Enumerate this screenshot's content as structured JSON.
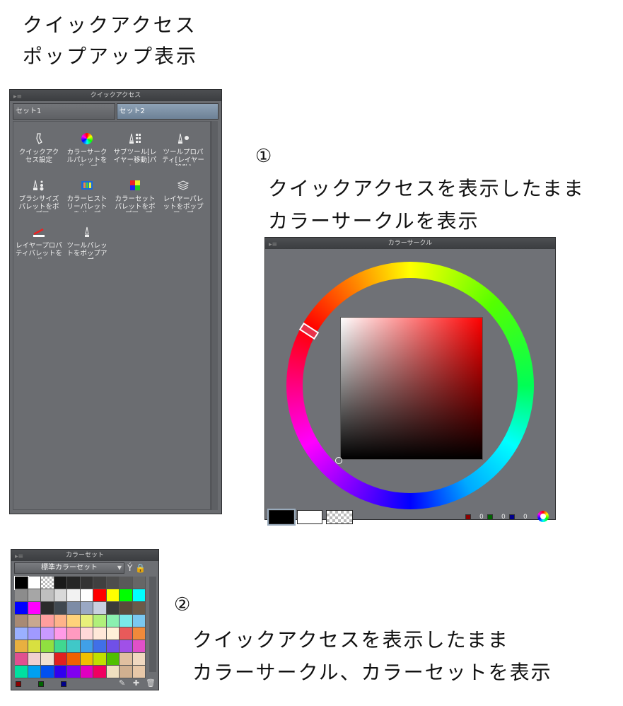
{
  "title_line1": "クイックアクセス",
  "title_line2": "ポップアップ表示",
  "label1": {
    "num": "①",
    "line1": "クイックアクセスを表示したまま",
    "line2": "カラーサークルを表示"
  },
  "label2": {
    "num": "②",
    "line1": "クイックアクセスを表示したまま",
    "line2": "カラーサークル、カラーセットを表示"
  },
  "quick_access": {
    "title": "クイックアクセス",
    "tabs": [
      "セット1",
      "セット2"
    ],
    "items": [
      {
        "label": "クイックアクセス設定",
        "icon": "quick-access-settings-icon"
      },
      {
        "label": "カラーサークルパレットをポップ",
        "icon": "color-circle-icon"
      },
      {
        "label": "サブツール[レイヤー移動]パレッ",
        "icon": "sub-tool-icon"
      },
      {
        "label": "ツールプロパティ[レイヤー移動]",
        "icon": "tool-property-icon"
      },
      {
        "label": "ブラシサイズパレットをポップア",
        "icon": "brush-size-icon"
      },
      {
        "label": "カラーヒストリーパレットをポップ",
        "icon": "color-history-icon"
      },
      {
        "label": "カラーセットパレットをポップアップ",
        "icon": "color-set-icon"
      },
      {
        "label": "レイヤーパレットをポップアップ",
        "icon": "layer-icon"
      },
      {
        "label": "レイヤープロパティパレットをポ",
        "icon": "layer-property-icon"
      },
      {
        "label": "ツールパレットをポップアップ",
        "icon": "tool-palette-icon"
      }
    ]
  },
  "color_circle": {
    "title": "カラーサークル",
    "main_color": "#000000",
    "sub_color": "#ffffff",
    "rgb": {
      "r": "0",
      "g": "0",
      "b": "0"
    }
  },
  "color_set": {
    "title": "カラーセット",
    "set_name": "標準カラーセット",
    "colors": [
      "#000000",
      "#ffffff",
      "checker",
      "#1a1a1a",
      "#262626",
      "#333333",
      "#404040",
      "#4d4d4d",
      "#595959",
      "#666666",
      "#8c8c8c",
      "#a6a6a6",
      "#bfbfbf",
      "#d9d9d9",
      "#f2f2f2",
      "#ffffff",
      "#ff0000",
      "#ffff00",
      "#00ff00",
      "#00ffff",
      "#0000ff",
      "#ff00ff",
      "#2b2b2b",
      "#404850",
      "#7d8ca6",
      "#9aa8c4",
      "#c8d0e0",
      "#3a3a3a",
      "#5a4a3a",
      "#6b5a48",
      "#a88a74",
      "#c8a890",
      "#ff9e9e",
      "#ffb38a",
      "#ffd27a",
      "#e8f07a",
      "#b0f07a",
      "#8af0b0",
      "#7ae8e8",
      "#7ac8f0",
      "#9ab0ff",
      "#a09aff",
      "#c89aff",
      "#ff9ae8",
      "#ff9ac0",
      "#ffd8d8",
      "#ffe8d8",
      "#fff0d8",
      "#e85a5a",
      "#f08a3a",
      "#e8b040",
      "#d8e040",
      "#90e040",
      "#40d890",
      "#40c8c8",
      "#40a0e8",
      "#4070e8",
      "#7050e8",
      "#a050e8",
      "#e050c8",
      "#e05090",
      "#f0d0d0",
      "#f0e0d0",
      "#e02020",
      "#f06000",
      "#f0c000",
      "#c0e000",
      "#50c000",
      "#e0c0a0",
      "#f0d8c0",
      "#00e0a0",
      "#00a0f0",
      "#0050f0",
      "#3000f0",
      "#8000f0",
      "#e000c0",
      "#f00060",
      "#f0e0c0",
      "#d0b090",
      "#e8c8a8"
    ],
    "footer": {
      "r": "",
      "g": "",
      "b": ""
    }
  }
}
